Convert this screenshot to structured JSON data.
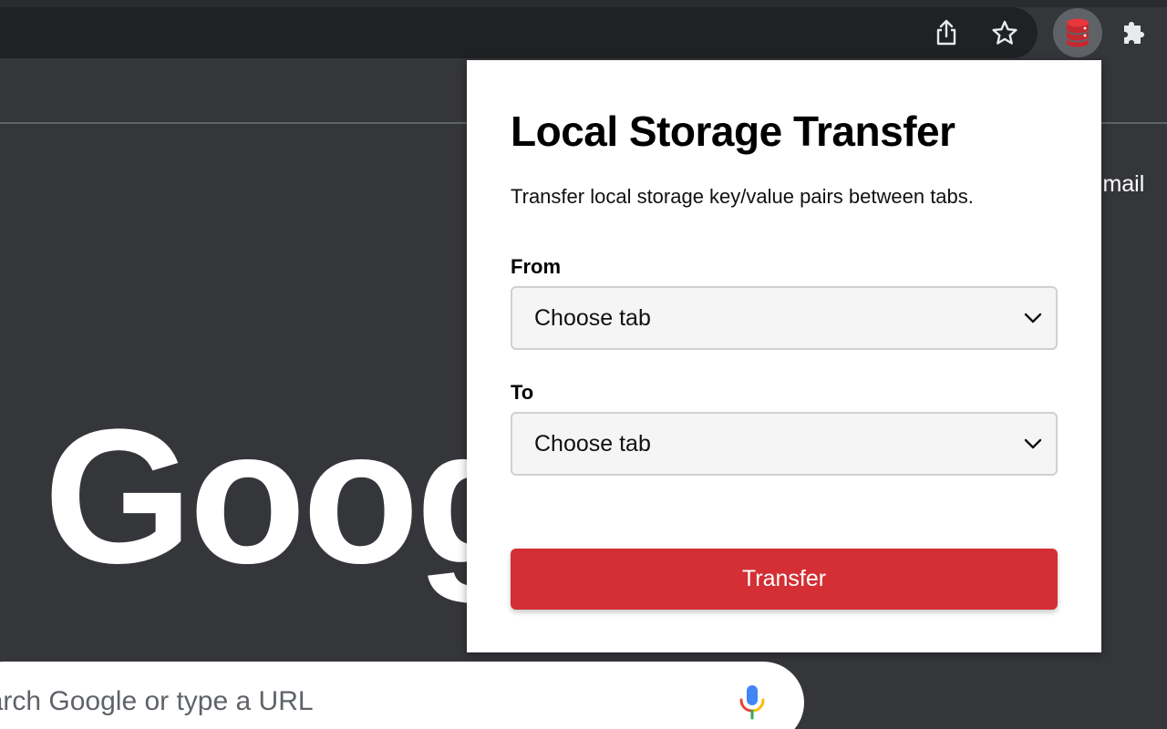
{
  "browser": {
    "toolbar_icons": [
      "share-icon",
      "star-icon",
      "database-icon",
      "puzzle-icon"
    ]
  },
  "page": {
    "gmail_link": "Gmail",
    "logo_text": "Google",
    "search_placeholder": "Search Google or type a URL"
  },
  "popup": {
    "title": "Local Storage Transfer",
    "description": "Transfer local storage key/value pairs between tabs.",
    "from_label": "From",
    "from_value": "Choose tab",
    "to_label": "To",
    "to_value": "Choose tab",
    "transfer_label": "Transfer"
  },
  "colors": {
    "accent_red": "#d32f34",
    "chrome_dark": "#35363a",
    "omnibox_dark": "#202124"
  }
}
